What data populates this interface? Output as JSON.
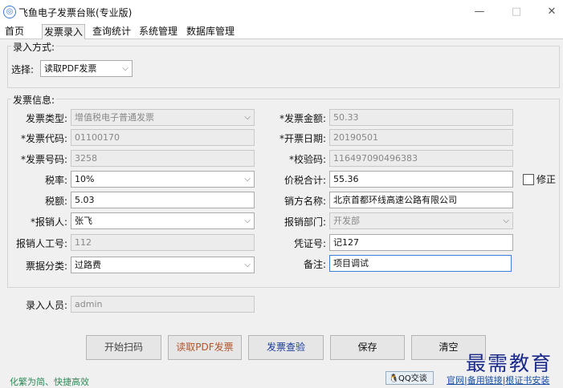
{
  "window": {
    "title": "飞鱼电子发票台账(专业版)",
    "minimize": "—",
    "maximize": "□",
    "close": "✕"
  },
  "tabs": [
    "首页",
    "发票录入",
    "查询统计",
    "系统管理",
    "数据库管理"
  ],
  "entry_mode": {
    "group_label": "录入方式:",
    "select_label": "选择:",
    "select_value": "读取PDF发票"
  },
  "invoice": {
    "group_label": "发票信息:",
    "type_label": "发票类型:",
    "type_value": "增值税电子普通发票",
    "code_label": "*发票代码:",
    "code_value": "01100170",
    "number_label": "*发票号码:",
    "number_value": "3258",
    "tax_rate_label": "税率:",
    "tax_rate_value": "10%",
    "tax_amount_label": "税额:",
    "tax_amount_value": "5.03",
    "reimburser_label": "*报销人:",
    "reimburser_value": "张飞",
    "reimburser_id_label": "报销人工号:",
    "reimburser_id_value": "112",
    "category_label": "票据分类:",
    "category_value": "过路费",
    "amount_label": "*发票金额:",
    "amount_value": "50.33",
    "date_label": "*开票日期:",
    "date_value": "20190501",
    "check_code_label": "*校验码:",
    "check_code_value": "116497090496383",
    "total_label": "价税合计:",
    "total_value": "55.36",
    "seller_label": "销方名称:",
    "seller_value": "北京首都环线高速公路有限公司",
    "dept_label": "报销部门:",
    "dept_value": "开发部",
    "voucher_label": "凭证号:",
    "voucher_value": "记127",
    "remark_label": "备注:",
    "remark_value": "项目调试",
    "correct_label": "修正"
  },
  "operator": {
    "label": "录入人员:",
    "value": "admin"
  },
  "buttons": {
    "scan": "开始扫码",
    "read_pdf": "读取PDF发票",
    "check": "发票查验",
    "save": "保存",
    "clear": "清空"
  },
  "footer": {
    "slogan": "化繁为简、快捷高效",
    "qq": "QQ交谈",
    "links": "官网|备用链接|根证书安装",
    "watermark": "最需教育"
  },
  "colors": {
    "read_pdf_text": "#b2552a",
    "check_text": "#1a3a9a",
    "slogan": "#2e8b57",
    "link": "#1a4fa0",
    "watermark": "#1a2a8a"
  }
}
